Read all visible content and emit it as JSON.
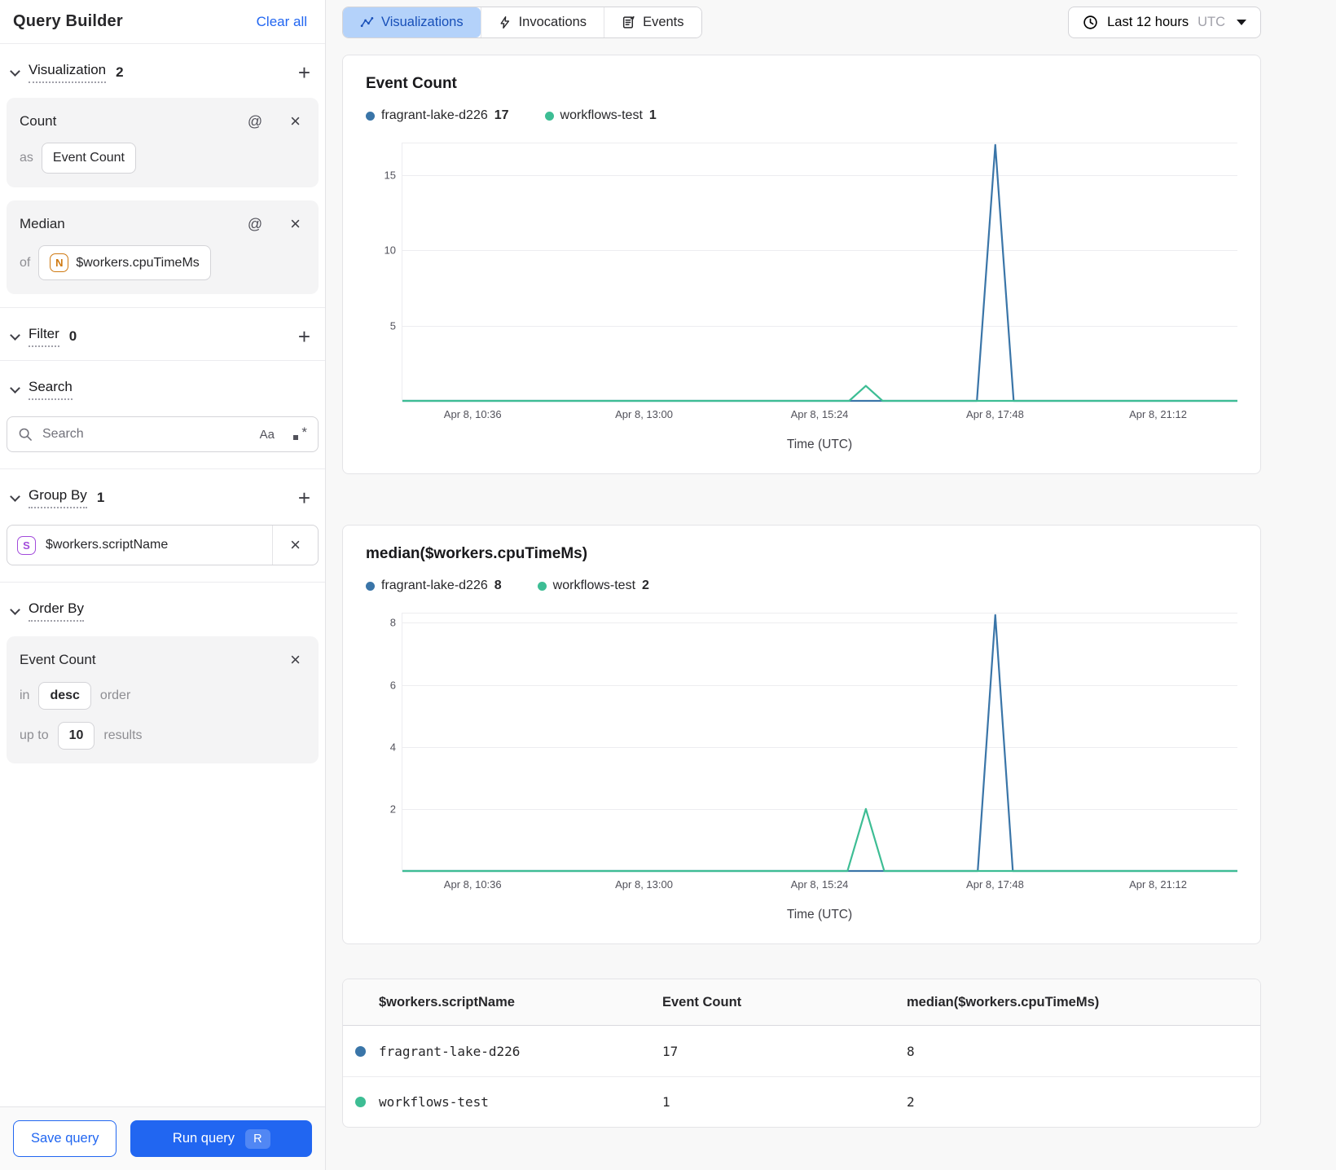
{
  "colors": {
    "accent_blue": "#2166f1",
    "tab_selected_bg": "#b4d2fa",
    "series_blue": "#3a75a8",
    "series_green": "#3dbd94"
  },
  "sidebar": {
    "title": "Query Builder",
    "clear_all": "Clear all",
    "visualization": {
      "label": "Visualization",
      "count": "2"
    },
    "count_card": {
      "title": "Count",
      "as_label": "as",
      "value": "Event Count"
    },
    "median_card": {
      "title": "Median",
      "of_label": "of",
      "field_icon_letter": "N",
      "value": "$workers.cpuTimeMs"
    },
    "filter": {
      "label": "Filter",
      "count": "0"
    },
    "search": {
      "label": "Search",
      "placeholder": "Search",
      "case_icon": "Aa",
      "regex_icon_star": "*"
    },
    "group_by": {
      "label": "Group By",
      "count": "1",
      "item_icon_letter": "S",
      "item": "$workers.scriptName"
    },
    "order_by": {
      "label": "Order By",
      "card": {
        "title": "Event Count",
        "in_label": "in",
        "direction": "desc",
        "order_label": "order",
        "up_to_label": "up to",
        "limit": "10",
        "results_label": "results"
      }
    },
    "footer": {
      "save": "Save query",
      "run": "Run query",
      "shortcut": "R"
    }
  },
  "header": {
    "tabs": [
      {
        "label": "Visualizations",
        "selected": true
      },
      {
        "label": "Invocations",
        "selected": false
      },
      {
        "label": "Events",
        "selected": false
      }
    ],
    "time_range": {
      "label": "Last 12 hours",
      "zone": "UTC"
    }
  },
  "chart_data": [
    {
      "type": "line",
      "title": "Event Count",
      "xlabel": "Time (UTC)",
      "ylim": [
        0,
        17.1
      ],
      "y_ticks": [
        5,
        10,
        15
      ],
      "x_ticks": [
        {
          "label": "Apr 8, 10:36",
          "f": 0.085
        },
        {
          "label": "Apr 8, 13:00",
          "f": 0.29
        },
        {
          "label": "Apr 8, 15:24",
          "f": 0.5
        },
        {
          "label": "Apr 8, 17:48",
          "f": 0.71
        },
        {
          "label": "Apr 8, 21:12",
          "f": 0.905
        }
      ],
      "series": [
        {
          "name": "fragrant-lake-d226",
          "legend_value": "17",
          "color": "#3a75a8",
          "points": [
            [
              0,
              0
            ],
            [
              0.688,
              0
            ],
            [
              0.71,
              17
            ],
            [
              0.732,
              0
            ],
            [
              1,
              0
            ]
          ]
        },
        {
          "name": "workflows-test",
          "legend_value": "1",
          "color": "#3dbd94",
          "points": [
            [
              0,
              0
            ],
            [
              0.535,
              0
            ],
            [
              0.555,
              1
            ],
            [
              0.575,
              0
            ],
            [
              1,
              0
            ]
          ]
        }
      ]
    },
    {
      "type": "line",
      "title": "median($workers.cpuTimeMs)",
      "xlabel": "Time (UTC)",
      "ylim": [
        0,
        8.3
      ],
      "y_ticks": [
        2,
        4,
        6,
        8
      ],
      "x_ticks": [
        {
          "label": "Apr 8, 10:36",
          "f": 0.085
        },
        {
          "label": "Apr 8, 13:00",
          "f": 0.29
        },
        {
          "label": "Apr 8, 15:24",
          "f": 0.5
        },
        {
          "label": "Apr 8, 17:48",
          "f": 0.71
        },
        {
          "label": "Apr 8, 21:12",
          "f": 0.905
        }
      ],
      "series": [
        {
          "name": "fragrant-lake-d226",
          "legend_value": "8",
          "color": "#3a75a8",
          "points": [
            [
              0,
              0
            ],
            [
              0.689,
              0
            ],
            [
              0.71,
              8.25
            ],
            [
              0.731,
              0
            ],
            [
              1,
              0
            ]
          ]
        },
        {
          "name": "workflows-test",
          "legend_value": "2",
          "color": "#3dbd94",
          "points": [
            [
              0,
              0
            ],
            [
              0.533,
              0
            ],
            [
              0.555,
              2
            ],
            [
              0.577,
              0
            ],
            [
              1,
              0
            ]
          ]
        }
      ]
    },
    {
      "type": "table",
      "columns": [
        "$workers.scriptName",
        "Event Count",
        "median($workers.cpuTimeMs)"
      ],
      "rows": [
        {
          "dot_color": "#3a75a8",
          "name": "fragrant-lake-d226",
          "values": [
            "17",
            "8"
          ]
        },
        {
          "dot_color": "#3dbd94",
          "name": "workflows-test",
          "values": [
            "1",
            "2"
          ]
        }
      ]
    }
  ]
}
